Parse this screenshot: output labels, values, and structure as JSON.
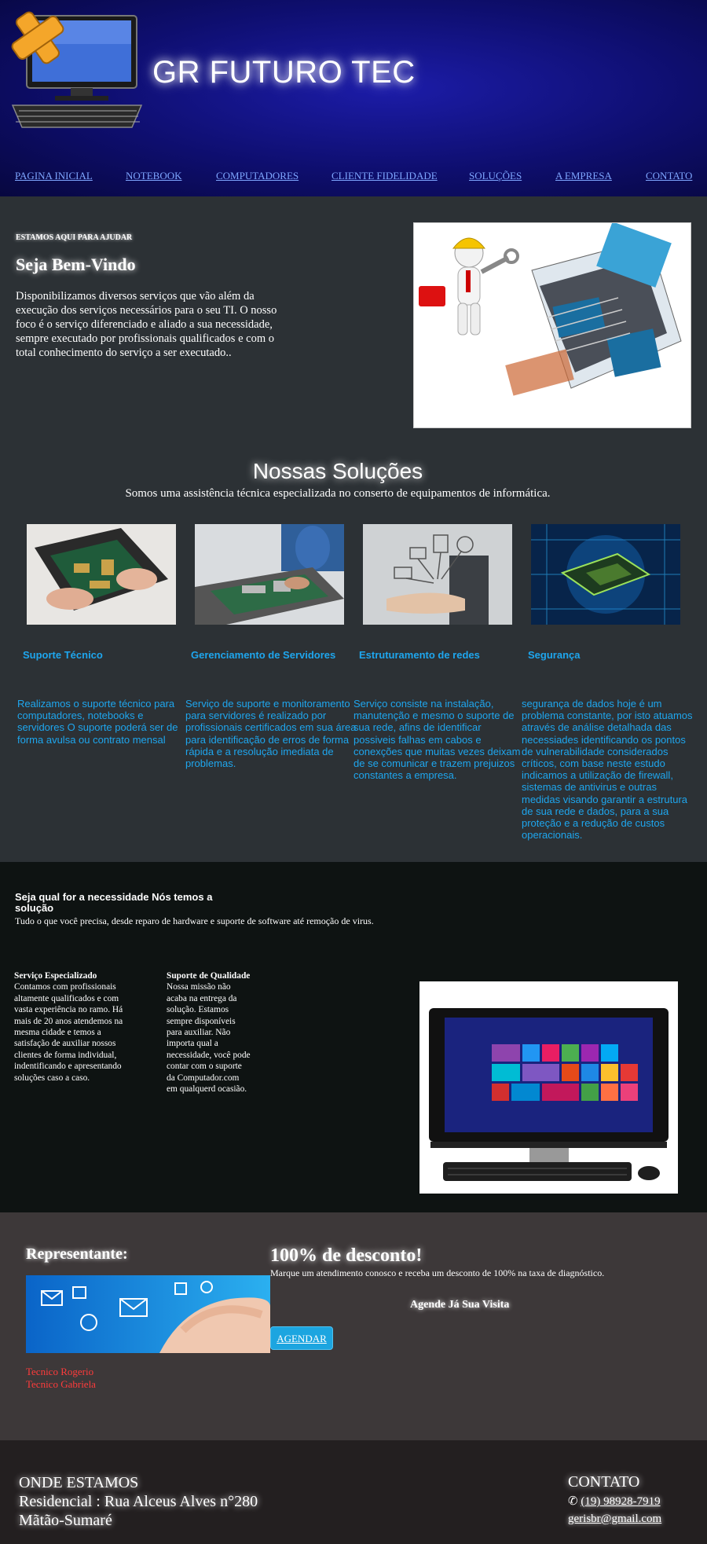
{
  "header": {
    "brand": "GR FUTURO TEC",
    "nav": [
      "PAGINA INICIAL",
      "NOTEBOOK",
      "COMPUTADORES",
      "CLIENTE FIDELIDADE",
      "SOLUÇÕES",
      "A EMPRESA",
      "CONTATO"
    ]
  },
  "welcome": {
    "eyebrow": "ESTAMOS AQUI PARA AJUDAR",
    "title": "Seja Bem-Vindo",
    "text": "Disponibilizamos diversos serviços que vão além da execução dos serviços necessários para o seu TI. O nosso foco é o serviço diferenciado e aliado a sua necessidade, sempre executado por profissionais qualificados e com o total conhecimento do serviço a ser executado.."
  },
  "solutions": {
    "title": "Nossas Soluções",
    "subtitle": "Somos uma assistência técnica especializada no conserto de equipamentos de informática.",
    "cards": [
      {
        "title": "Suporte Técnico",
        "text": "Realizamos o suporte técnico para computadores, notebooks e servidores O suporte poderá ser de forma avulsa ou contrato mensal"
      },
      {
        "title": "Gerenciamento de Servidores",
        "text": "Serviço de suporte e monitoramento para servidores é realizado por profissionais certificados em sua área para identificação de erros de forma rápida e a resolução imediata de problemas."
      },
      {
        "title": "Estruturamento de redes",
        "text": "Serviço consiste na instalação, manutenção e mesmo o suporte de sua rede, afins de identificar possiveis falhas em cabos e conexções que muitas vezes deixam de se comunicar e trazem prejuizos constantes a empresa."
      },
      {
        "title": "Segurança",
        "text": "segurança de dados hoje é um problema constante, por isto atuamos através de análise detalhada das necessiades identificando os pontos de vulnerabilidade considerados críticos, com base neste estudo indicamos a utilização de firewall, sistemas de antivirus e outras medidas visando garantir a estrutura de sua rede e dados, para a sua proteção e a redução de custos operacionais."
      }
    ]
  },
  "need": {
    "title": "Seja qual for a necessidade Nós temos a solução",
    "subtitle": "Tudo o que você precisa, desde reparo de hardware e suporte de software até remoção de virus.",
    "col1_title": "Serviço Especializado",
    "col1_text": "Contamos com profissionais altamente qualificados e com vasta experiência no ramo. Há mais de 20 anos atendemos na mesma cidade e temos a satisfação de auxiliar nossos clientes de forma individual, indentificando e apresentando soluções caso a caso.",
    "col2_title": "Suporte de Qualidade",
    "col2_text": "Nossa missão não acaba na entrega da solução. Estamos sempre disponíveis para auxiliar. Não importa qual a necessidade, você pode contar com o suporte da Computador.com em qualquerd ocasião."
  },
  "promo": {
    "rep_title": "Representante:",
    "reps": [
      "Tecnico Rogerio",
      "Tecnico Gabriela"
    ],
    "discount_title": "100% de desconto!",
    "discount_text": "Marque um atendimento conosco e receba um desconto de 100% na taxa de diagnóstico.",
    "cta_text": "Agende Já Sua Visita",
    "button": "AGENDAR"
  },
  "footer": {
    "location_title": "ONDE ESTAMOS",
    "address": "Residencial : Rua Alceus Alves n°280",
    "city": "Mãtão-Sumaré",
    "contact_title": "CONTATO",
    "phone": "(19) 98928-7919",
    "email": "gerisbr@gmail.com"
  }
}
